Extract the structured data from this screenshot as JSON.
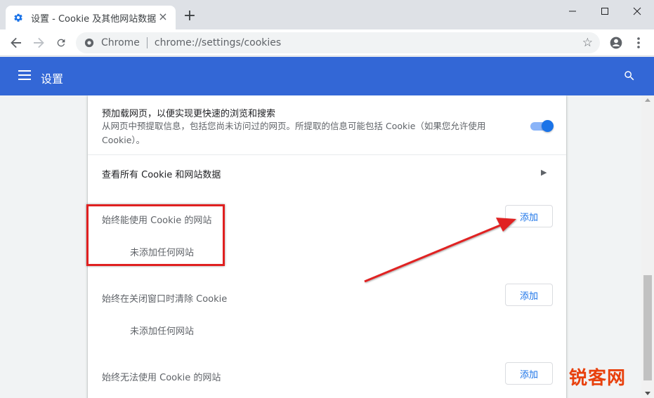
{
  "tab": {
    "title": "设置 - Cookie 及其他网站数据",
    "close_label": "×",
    "new_tab_label": "+"
  },
  "window_controls": {
    "minimize": "—",
    "maximize": "☐",
    "close": "✕"
  },
  "omnibox": {
    "chip": "Chrome",
    "url": "chrome://settings/cookies"
  },
  "header": {
    "title": "设置"
  },
  "rows": {
    "preload": {
      "label": "预加载网页，以便实现更快速的浏览和搜索",
      "desc": "从网页中预提取信息，包括您尚未访问过的网页。所提取的信息可能包括 Cookie（如果您允许使用 Cookie）。",
      "enabled": true
    },
    "see_all": {
      "label": "查看所有 Cookie 和网站数据"
    }
  },
  "sections": [
    {
      "title": "始终能使用 Cookie 的网站",
      "button": "添加",
      "empty": "未添加任何网站"
    },
    {
      "title": "始终在关闭窗口时清除 Cookie",
      "button": "添加",
      "empty": "未添加任何网站"
    },
    {
      "title": "始终无法使用 Cookie 的网站",
      "button": "添加",
      "empty": ""
    }
  ],
  "watermark": "锐客网",
  "colors": {
    "header": "#3367d6",
    "annotation": "#e02020",
    "toggle_on": "#1a73e8"
  }
}
